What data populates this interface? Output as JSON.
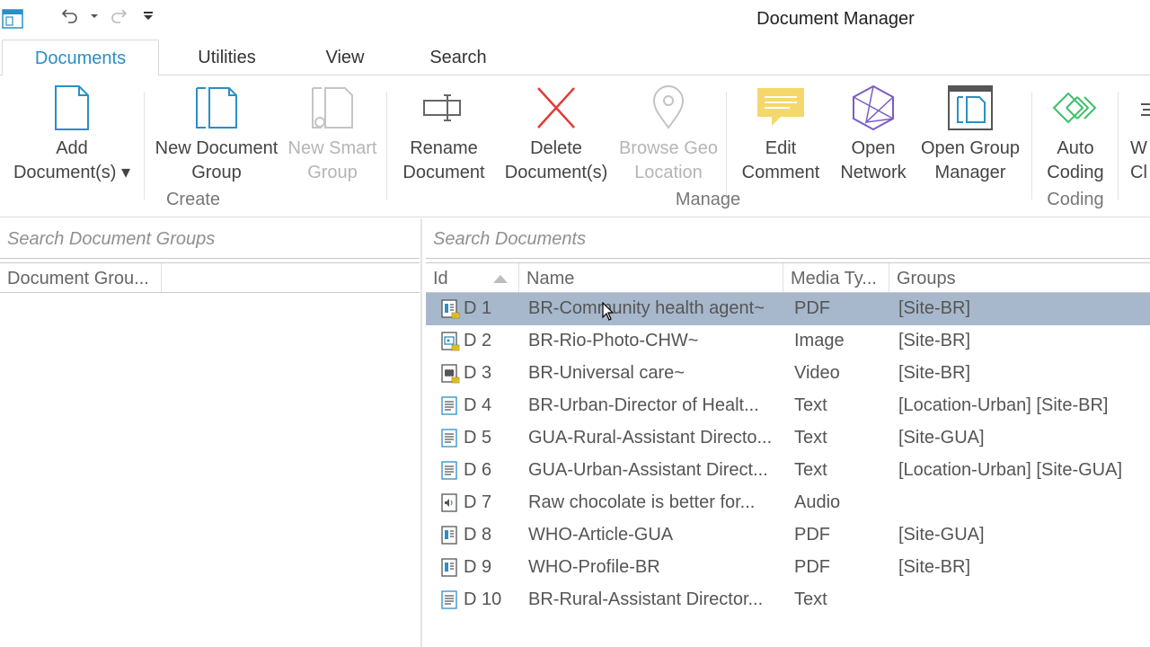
{
  "window": {
    "title": "Document Manager"
  },
  "tabs": [
    {
      "label": "Documents"
    },
    {
      "label": "Utilities"
    },
    {
      "label": "View"
    },
    {
      "label": "Search"
    }
  ],
  "ribbon": {
    "groups": {
      "create": "Create",
      "manage": "Manage",
      "coding": "Coding"
    },
    "buttons": {
      "add_documents": "Add\nDocument(s) ▾",
      "new_document_group": "New Document\nGroup",
      "new_smart_group": "New Smart\nGroup",
      "rename_document": "Rename\nDocument",
      "delete_documents": "Delete\nDocument(s)",
      "browse_geo_location": "Browse Geo\nLocation",
      "edit_comment": "Edit\nComment",
      "open_network": "Open\nNetwork",
      "open_group_manager": "Open Group\nManager",
      "auto_coding": "Auto\nCoding",
      "partial": "W\nCl"
    }
  },
  "left_pane": {
    "search_placeholder": "Search Document Groups",
    "columns": [
      "Document Grou..."
    ]
  },
  "right_pane": {
    "search_placeholder": "Search Documents",
    "columns": [
      "Id",
      "Name",
      "Media Ty...",
      "Groups"
    ],
    "documents": [
      {
        "id": "D 1",
        "name": "BR-Community health agent~",
        "media": "PDF",
        "groups": "[Site-BR]",
        "icon": "pdf-icon"
      },
      {
        "id": "D 2",
        "name": "BR-Rio-Photo-CHW~",
        "media": "Image",
        "groups": "[Site-BR]",
        "icon": "image-icon"
      },
      {
        "id": "D 3",
        "name": "BR-Universal care~",
        "media": "Video",
        "groups": "[Site-BR]",
        "icon": "video-icon"
      },
      {
        "id": "D 4",
        "name": "BR-Urban-Director of Healt...",
        "media": "Text",
        "groups": "[Location-Urban] [Site-BR]",
        "icon": "text-icon"
      },
      {
        "id": "D 5",
        "name": "GUA-Rural-Assistant Directo...",
        "media": "Text",
        "groups": "[Site-GUA]",
        "icon": "text-icon"
      },
      {
        "id": "D 6",
        "name": "GUA-Urban-Assistant Direct...",
        "media": "Text",
        "groups": "[Location-Urban] [Site-GUA]",
        "icon": "text-icon"
      },
      {
        "id": "D 7",
        "name": "Raw chocolate is better for...",
        "media": "Audio",
        "groups": "",
        "icon": "audio-icon"
      },
      {
        "id": "D 8",
        "name": "WHO-Article-GUA",
        "media": "PDF",
        "groups": "[Site-GUA]",
        "icon": "pdf-icon"
      },
      {
        "id": "D 9",
        "name": "WHO-Profile-BR",
        "media": "PDF",
        "groups": "[Site-BR]",
        "icon": "pdf-icon"
      },
      {
        "id": "D 10",
        "name": "BR-Rural-Assistant Director...",
        "media": "Text",
        "groups": "",
        "icon": "text-icon"
      }
    ]
  },
  "colors": {
    "accent": "#2a8fc5",
    "selected_row": "#a7b8cc",
    "delete": "#e53935",
    "comment": "#f5d86b"
  }
}
